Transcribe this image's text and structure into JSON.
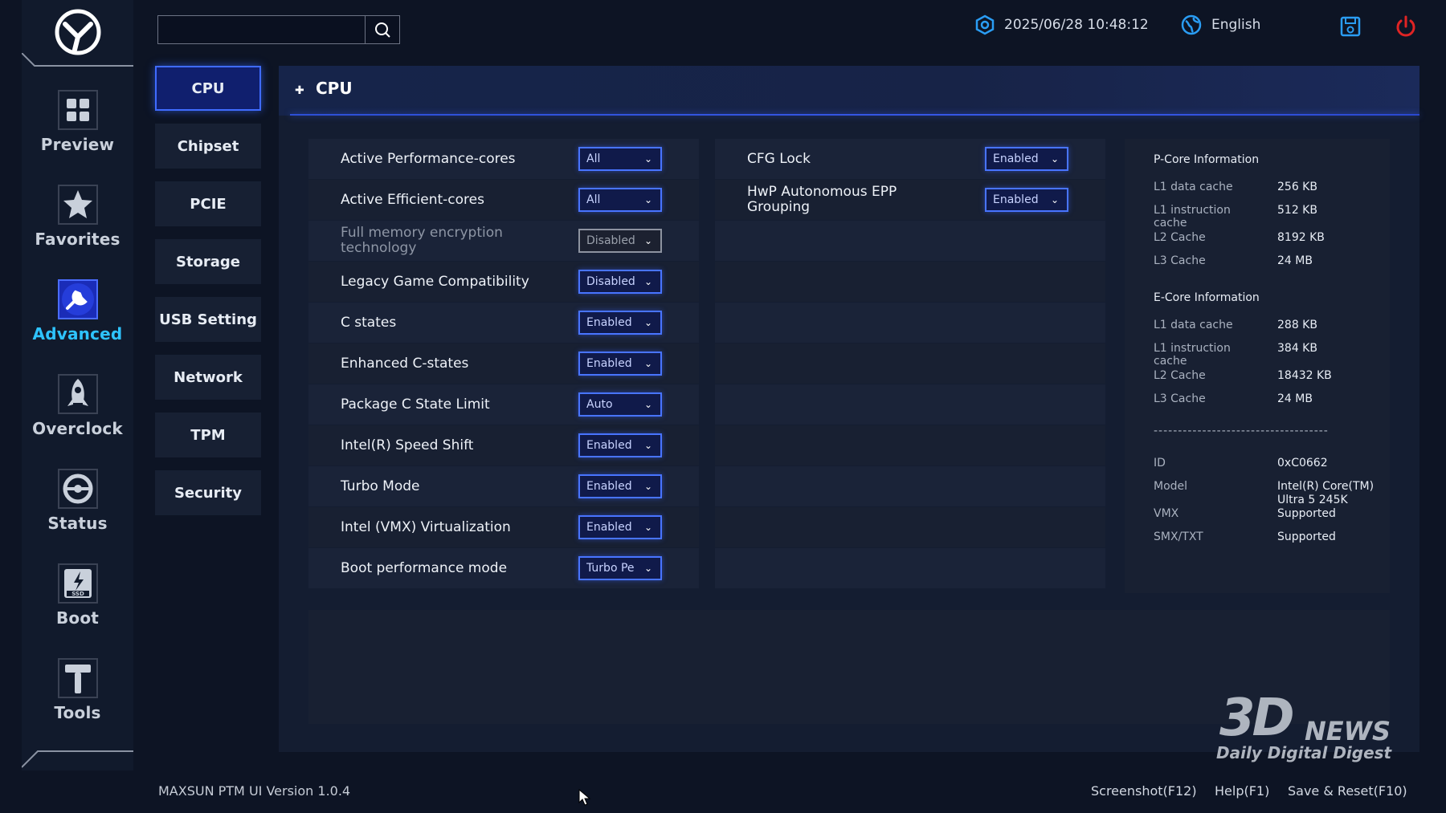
{
  "header": {
    "datetime": "2025/06/28 10:48:12",
    "language": "English",
    "search_placeholder": "",
    "icons": {
      "datetime": "gear-hexagon-icon",
      "language": "globe-icon",
      "save": "floppy-disk-icon",
      "power": "power-icon"
    },
    "colors": {
      "accent": "#2ec3ff",
      "power": "#e02424",
      "save": "#2a9df4"
    }
  },
  "nav": {
    "items": [
      {
        "label": "Preview",
        "icon": "grid-icon"
      },
      {
        "label": "Favorites",
        "icon": "star-icon"
      },
      {
        "label": "Advanced",
        "icon": "wrench-icon",
        "active": true
      },
      {
        "label": "Overclock",
        "icon": "rocket-icon"
      },
      {
        "label": "Status",
        "icon": "gauge-icon"
      },
      {
        "label": "Boot",
        "icon": "ssd-icon"
      },
      {
        "label": "Tools",
        "icon": "hammer-icon"
      }
    ]
  },
  "submenu": {
    "items": [
      "CPU",
      "Chipset",
      "PCIE",
      "Storage",
      "USB Setting",
      "Network",
      "TPM",
      "Security"
    ],
    "active": "CPU"
  },
  "panel": {
    "title": "CPU",
    "left_settings": [
      {
        "label": "Active Performance-cores",
        "value": "All"
      },
      {
        "label": "Active Efficient-cores",
        "value": "All"
      },
      {
        "label": "Full memory encryption technology",
        "value": "Disabled",
        "disabled": true
      },
      {
        "label": "Legacy Game Compatibility",
        "value": "Disabled"
      },
      {
        "label": "C states",
        "value": "Enabled"
      },
      {
        "label": "Enhanced C-states",
        "value": "Enabled"
      },
      {
        "label": "Package C State Limit",
        "value": "Auto"
      },
      {
        "label": "Intel(R) Speed Shift",
        "value": "Enabled"
      },
      {
        "label": "Turbo Mode",
        "value": "Enabled"
      },
      {
        "label": "Intel (VMX) Virtualization",
        "value": "Enabled"
      },
      {
        "label": "Boot performance mode",
        "value": "Turbo Pe"
      }
    ],
    "right_settings": [
      {
        "label": "CFG Lock",
        "value": "Enabled"
      },
      {
        "label": "HwP Autonomous EPP Grouping",
        "value": "Enabled"
      }
    ]
  },
  "info": {
    "pcore_title": "P-Core Information",
    "pcore": [
      {
        "k": "L1 data cache",
        "v": "256 KB"
      },
      {
        "k": "L1 instruction cache",
        "v": "512 KB"
      },
      {
        "k": "L2 Cache",
        "v": "8192 KB"
      },
      {
        "k": "L3 Cache",
        "v": "24 MB"
      }
    ],
    "ecore_title": "E-Core Information",
    "ecore": [
      {
        "k": "L1 data cache",
        "v": "288 KB"
      },
      {
        "k": "L1 instruction cache",
        "v": "384 KB"
      },
      {
        "k": "L2 Cache",
        "v": "18432 KB"
      },
      {
        "k": "L3 Cache",
        "v": "24 MB"
      }
    ],
    "separator": "------------------------------------",
    "cpu": [
      {
        "k": "ID",
        "v": "0xC0662"
      },
      {
        "k": "Model",
        "v": "Intel(R) Core(TM) Ultra 5 245K"
      },
      {
        "k": "VMX",
        "v": "Supported"
      },
      {
        "k": "SMX/TXT",
        "v": "Supported"
      }
    ]
  },
  "footer": {
    "version": "MAXSUN PTM UI Version 1.0.4",
    "screenshot": "Screenshot(F12)",
    "help": "Help(F1)",
    "save_reset": "Save & Reset(F10)"
  },
  "watermark": {
    "brand": "3D",
    "news": "NEWS",
    "tagline": "Daily Digital Digest"
  }
}
